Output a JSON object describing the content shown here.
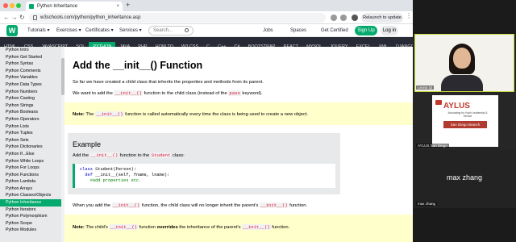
{
  "browser": {
    "tab_title": "Python Inheritance",
    "tab_close": "×",
    "new_tab": "+",
    "address": "w3schools.com/python/python_inheritance.asp",
    "relaunch": "Relaunch to update",
    "nav": {
      "back": "←",
      "forward": "→",
      "reload": "↻"
    },
    "menu": "⋮"
  },
  "header": {
    "logo": "W",
    "logo_text": "w3schools",
    "menus": [
      "Tutorials ▾",
      "Exercises ▾",
      "Certificates ▾",
      "Services ▾"
    ],
    "search_placeholder": "Search...",
    "links": [
      "Jobs",
      "Spaces",
      "Get Certified"
    ],
    "signup": "Sign Up",
    "login": "Log in"
  },
  "topnav": [
    "HTML",
    "CSS",
    "JAVASCRIPT",
    "SQL",
    "PYTHON",
    "JAVA",
    "PHP",
    "HOW TO",
    "W3.CSS",
    "C",
    "C++",
    "C#",
    "BOOTSTRAP",
    "REACT",
    "MYSQL",
    "JQUERY",
    "EXCEL",
    "XML",
    "DJANGO"
  ],
  "topnav_active": "PYTHON",
  "sidebar": {
    "items": [
      "Python Intro",
      "Python Get Started",
      "Python Syntax",
      "Python Comments",
      "Python Variables",
      "Python Data Types",
      "Python Numbers",
      "Python Casting",
      "Python Strings",
      "Python Booleans",
      "Python Operators",
      "Python Lists",
      "Python Tuples",
      "Python Sets",
      "Python Dictionaries",
      "Python If...Else",
      "Python While Loops",
      "Python For Loops",
      "Python Functions",
      "Python Lambda",
      "Python Arrays",
      "Python Classes/Objects",
      "Python Inheritance",
      "Python Iterators",
      "Python Polymorphism",
      "Python Scope",
      "Python Modules"
    ],
    "active": "Python Inheritance"
  },
  "main": {
    "title": "Add the __init__() Function",
    "p1": "So far we have created a child class that inherits the properties and methods from its parent.",
    "p2_a": "We want to add the ",
    "p2_code": "__init__()",
    "p2_b": " function to the child class (instead of the ",
    "p2_code2": "pass",
    "p2_c": " keyword).",
    "note1_label": "Note:",
    "note1_a": " The ",
    "note1_code": "__init__()",
    "note1_b": " function is called automatically every time the class is being used to create a new object.",
    "example_title": "Example",
    "example_a": "Add the ",
    "example_code": "__init__()",
    "example_b": " function to the ",
    "example_code2": "Student",
    "example_c": " class:",
    "code_l1_kw": "class",
    "code_l1": " Student(Person):",
    "code_l2_kw": "  def",
    "code_l2": " __init__(self, fname, lname):",
    "code_l3": "    #add properties etc.",
    "p3_a": "When you add the ",
    "p3_code": "__init__()",
    "p3_b": " function, the child class will no longer inherit the parent's ",
    "p3_code2": "__init__()",
    "p3_c": " function.",
    "note2_label": "Note:",
    "note2_a": " The child's ",
    "note2_code": "__init__()",
    "note2_b": " function ",
    "note2_bold": "overrides",
    "note2_c": " the inheritance of the parent's ",
    "note2_code2": "__init__()",
    "note2_d": " function."
  },
  "zoom": {
    "tile1_name": "Leona Qi",
    "slide_title": "AYLUS",
    "slide_sub": "Advocating for Youth Leadership & Service",
    "slide_branch": "San Diego Branch",
    "tile2_name": "AYLUS San Diego",
    "tile3_big": "max zhang",
    "tile3_name": "max zhang"
  },
  "colors": {
    "accent": "#04aa6d",
    "code": "#dc143c",
    "note_bg": "#ffffcc",
    "topnav_bg": "#282a35"
  }
}
